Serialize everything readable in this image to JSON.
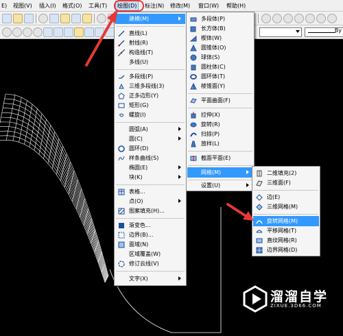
{
  "menubar": {
    "items": [
      {
        "label": "E)"
      },
      {
        "label": "视图(V)"
      },
      {
        "label": "插入(I)"
      },
      {
        "label": "格式(O)"
      },
      {
        "label": "工具(T)"
      },
      {
        "label": "绘图(D)",
        "active": true
      },
      {
        "label": "标注(N)"
      },
      {
        "label": "修改(M)"
      },
      {
        "label": "窗口(W)"
      },
      {
        "label": "帮助(H)"
      }
    ]
  },
  "toolbar": {
    "linetype_sample_label": "By"
  },
  "draw_menu": {
    "items": [
      {
        "label": "建模(M)",
        "icon": "none",
        "submenu": true,
        "selected": true
      },
      {
        "label": "直线(L)",
        "icon": "line-icon"
      },
      {
        "label": "射线(R)",
        "icon": "ray-icon"
      },
      {
        "label": "构造线(T)",
        "icon": "xline-icon"
      },
      {
        "label": "多线(U)",
        "icon": "none"
      },
      {
        "label": "多段线(P)",
        "icon": "polyline-icon"
      },
      {
        "label": "三维多段线(3)",
        "icon": "3dpoly-icon"
      },
      {
        "label": "正多边形(Y)",
        "icon": "polygon-icon"
      },
      {
        "label": "矩形(G)",
        "icon": "rectangle-icon"
      },
      {
        "label": "螺旋(I)",
        "icon": "helix-icon"
      },
      {
        "label": "圆弧(A)",
        "icon": "none",
        "submenu": true
      },
      {
        "label": "圆(C)",
        "icon": "none",
        "submenu": true
      },
      {
        "label": "圆环(D)",
        "icon": "donut-icon"
      },
      {
        "label": "样条曲线(S)",
        "icon": "spline-icon"
      },
      {
        "label": "椭圆(E)",
        "icon": "none",
        "submenu": true
      },
      {
        "label": "块(K)",
        "icon": "none",
        "submenu": true
      },
      {
        "label": "表格...",
        "icon": "table-icon"
      },
      {
        "label": "点(O)",
        "icon": "none",
        "submenu": true
      },
      {
        "label": "图案填充(H)...",
        "icon": "hatch-icon"
      },
      {
        "label": "渐变色...",
        "icon": "gradient-icon"
      },
      {
        "label": "边界(B)...",
        "icon": "boundary-icon"
      },
      {
        "label": "面域(N)",
        "icon": "region-icon"
      },
      {
        "label": "区域覆盖(W)",
        "icon": "none"
      },
      {
        "label": "修订云线(V)",
        "icon": "revcloud-icon"
      },
      {
        "label": "文字(X)",
        "icon": "none",
        "submenu": true
      }
    ]
  },
  "modeling_menu": {
    "items": [
      {
        "label": "多段体(P)",
        "icon": "polysolid-icon"
      },
      {
        "label": "长方体(B)",
        "icon": "box-icon"
      },
      {
        "label": "楔体(W)",
        "icon": "wedge-icon"
      },
      {
        "label": "圆锥体(O)",
        "icon": "cone-icon"
      },
      {
        "label": "球体(S)",
        "icon": "sphere-icon"
      },
      {
        "label": "圆柱体(C)",
        "icon": "cylinder-icon"
      },
      {
        "label": "圆环体(T)",
        "icon": "torus-icon"
      },
      {
        "label": "棱锥面(Y)",
        "icon": "pyramid-icon"
      },
      {
        "label": "平面曲面(F)",
        "icon": "planesurf-icon"
      },
      {
        "label": "拉伸(X)",
        "icon": "extrude-icon"
      },
      {
        "label": "旋转(R)",
        "icon": "revolve-icon"
      },
      {
        "label": "扫掠(P)",
        "icon": "sweep-icon"
      },
      {
        "label": "放样(L)",
        "icon": "loft-icon"
      },
      {
        "label": "截面平面(E)",
        "icon": "sectionplane-icon"
      },
      {
        "label": "网格(M)",
        "icon": "none",
        "submenu": true,
        "selected": true
      },
      {
        "label": "设置(U)",
        "icon": "none",
        "submenu": true
      }
    ]
  },
  "mesh_menu": {
    "items": [
      {
        "label": "二维填充(2)",
        "icon": "solid2d-icon"
      },
      {
        "label": "三维面(F)",
        "icon": "3dface-icon"
      },
      {
        "label": "边(E)",
        "icon": "edge-icon"
      },
      {
        "label": "三维网格(M)",
        "icon": "3dmesh-icon"
      },
      {
        "label": "旋转网格(M)",
        "icon": "revsurf-icon",
        "selected": true
      },
      {
        "label": "平移网格(T)",
        "icon": "tabsurf-icon"
      },
      {
        "label": "直纹网格(R)",
        "icon": "rulesurf-icon"
      },
      {
        "label": "边界网格(D)",
        "icon": "edgesurf-icon"
      }
    ]
  },
  "watermark": {
    "brand": "溜溜自学",
    "url": "ZIXUE.3D66.COM"
  },
  "colors": {
    "highlight": "#3399ff",
    "annotation_red": "#e53935",
    "menu_bg": "#f5f5f5",
    "canvas_bg": "#000000"
  }
}
